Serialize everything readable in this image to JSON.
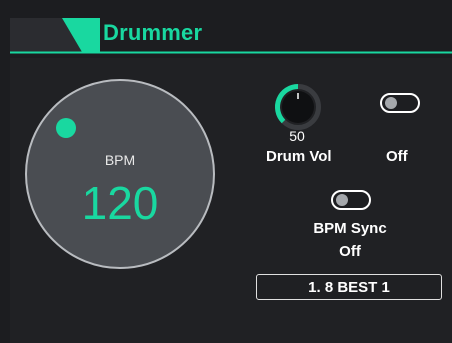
{
  "header": {
    "title": "Drummer"
  },
  "bpm": {
    "label": "BPM",
    "value": "120"
  },
  "drum_vol": {
    "value": "50",
    "label": "Drum Vol",
    "level": 0.5
  },
  "toggle_right": {
    "state": "Off"
  },
  "bpm_sync": {
    "label": "BPM Sync",
    "state": "Off"
  },
  "preset": {
    "name": "1. 8 BEST 1"
  },
  "colors": {
    "accent": "#19d8a0",
    "background": "#202124",
    "circle": "#4a4d52"
  }
}
